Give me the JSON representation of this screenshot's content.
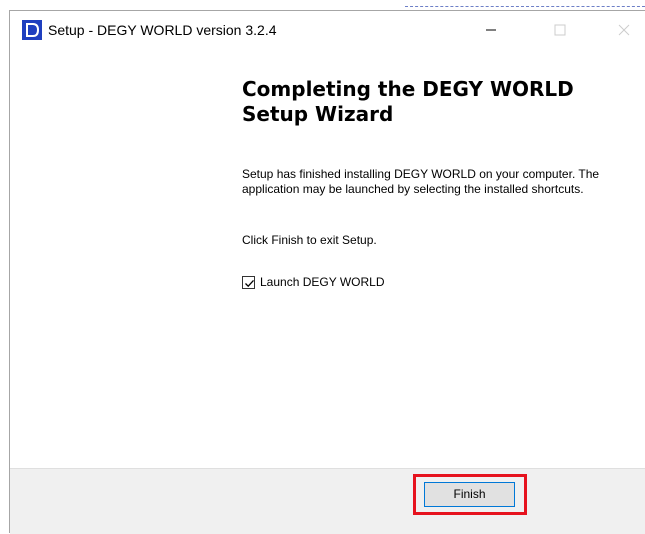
{
  "window": {
    "title": "Setup - DEGY WORLD version 3.2.4",
    "controls": {
      "minimize": "—",
      "maximize": "☐",
      "close": "✕"
    }
  },
  "wizard": {
    "heading": "Completing the DEGY WORLD Setup Wizard",
    "message": "Setup has finished installing DEGY WORLD on your computer. The application may be launched by selecting the installed shortcuts.",
    "exit_hint": "Click Finish to exit Setup.",
    "launch_option": {
      "label": "Launch DEGY WORLD",
      "checked": true
    }
  },
  "footer": {
    "finish_label": "Finish"
  },
  "colors": {
    "highlight": "#e6121e",
    "button_border": "#0078d7",
    "footer_bg": "#f0f0f0"
  }
}
